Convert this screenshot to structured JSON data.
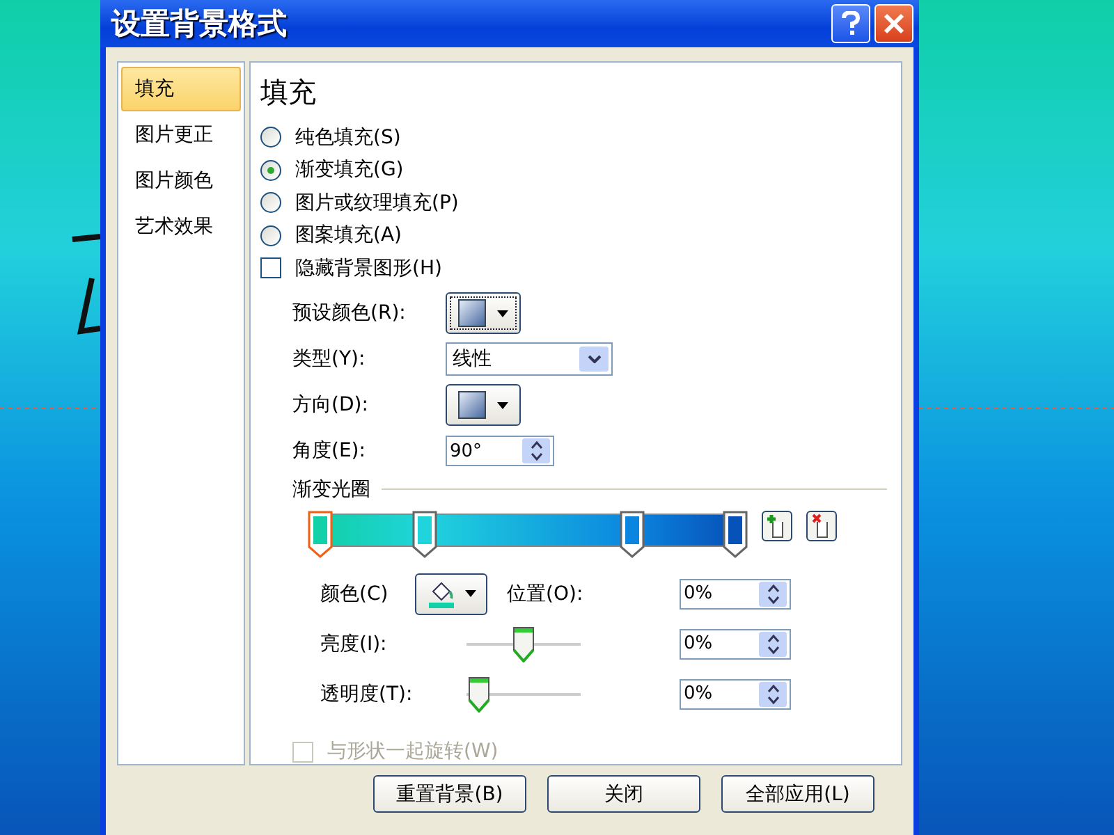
{
  "window": {
    "title": "设置背景格式"
  },
  "sidebar": {
    "items": [
      {
        "label": "填充",
        "selected": true
      },
      {
        "label": "图片更正",
        "selected": false
      },
      {
        "label": "图片颜色",
        "selected": false
      },
      {
        "label": "艺术效果",
        "selected": false
      }
    ]
  },
  "panel": {
    "heading": "填充",
    "fill_options": [
      {
        "label": "纯色填充(S)",
        "selected": false
      },
      {
        "label": "渐变填充(G)",
        "selected": true
      },
      {
        "label": "图片或纹理填充(P)",
        "selected": false
      },
      {
        "label": "图案填充(A)",
        "selected": false
      }
    ],
    "hide_background": {
      "label": "隐藏背景图形(H)",
      "checked": false
    },
    "preset_colors": {
      "label": "预设颜色(R):"
    },
    "type": {
      "label": "类型(Y):",
      "value": "线性"
    },
    "direction": {
      "label": "方向(D):"
    },
    "angle": {
      "label": "角度(E):",
      "value": "90°"
    },
    "gradient_stops": {
      "label": "渐变光圈",
      "stops": [
        {
          "level": 0,
          "color": "#12d0a8",
          "selected": true
        },
        {
          "level": 0.25,
          "color": "#20d4dc",
          "selected": false
        },
        {
          "level": 0.75,
          "color": "#0b86e0",
          "selected": false
        },
        {
          "level": 1,
          "color": "#0752b8",
          "selected": false
        }
      ]
    },
    "color": {
      "label": "颜色(C)"
    },
    "position": {
      "label": "位置(O):",
      "value": "0%"
    },
    "brightness": {
      "label": "亮度(I):",
      "level": 0.5,
      "value": "0%"
    },
    "transparency": {
      "label": "透明度(T):",
      "level": 0,
      "value": "0%"
    },
    "rotate_with_shape": {
      "label": "与形状一起旋转(W)",
      "checked": false,
      "disabled": true
    }
  },
  "buttons": [
    "重置背景(B)",
    "关闭",
    "全部应用(L)"
  ]
}
